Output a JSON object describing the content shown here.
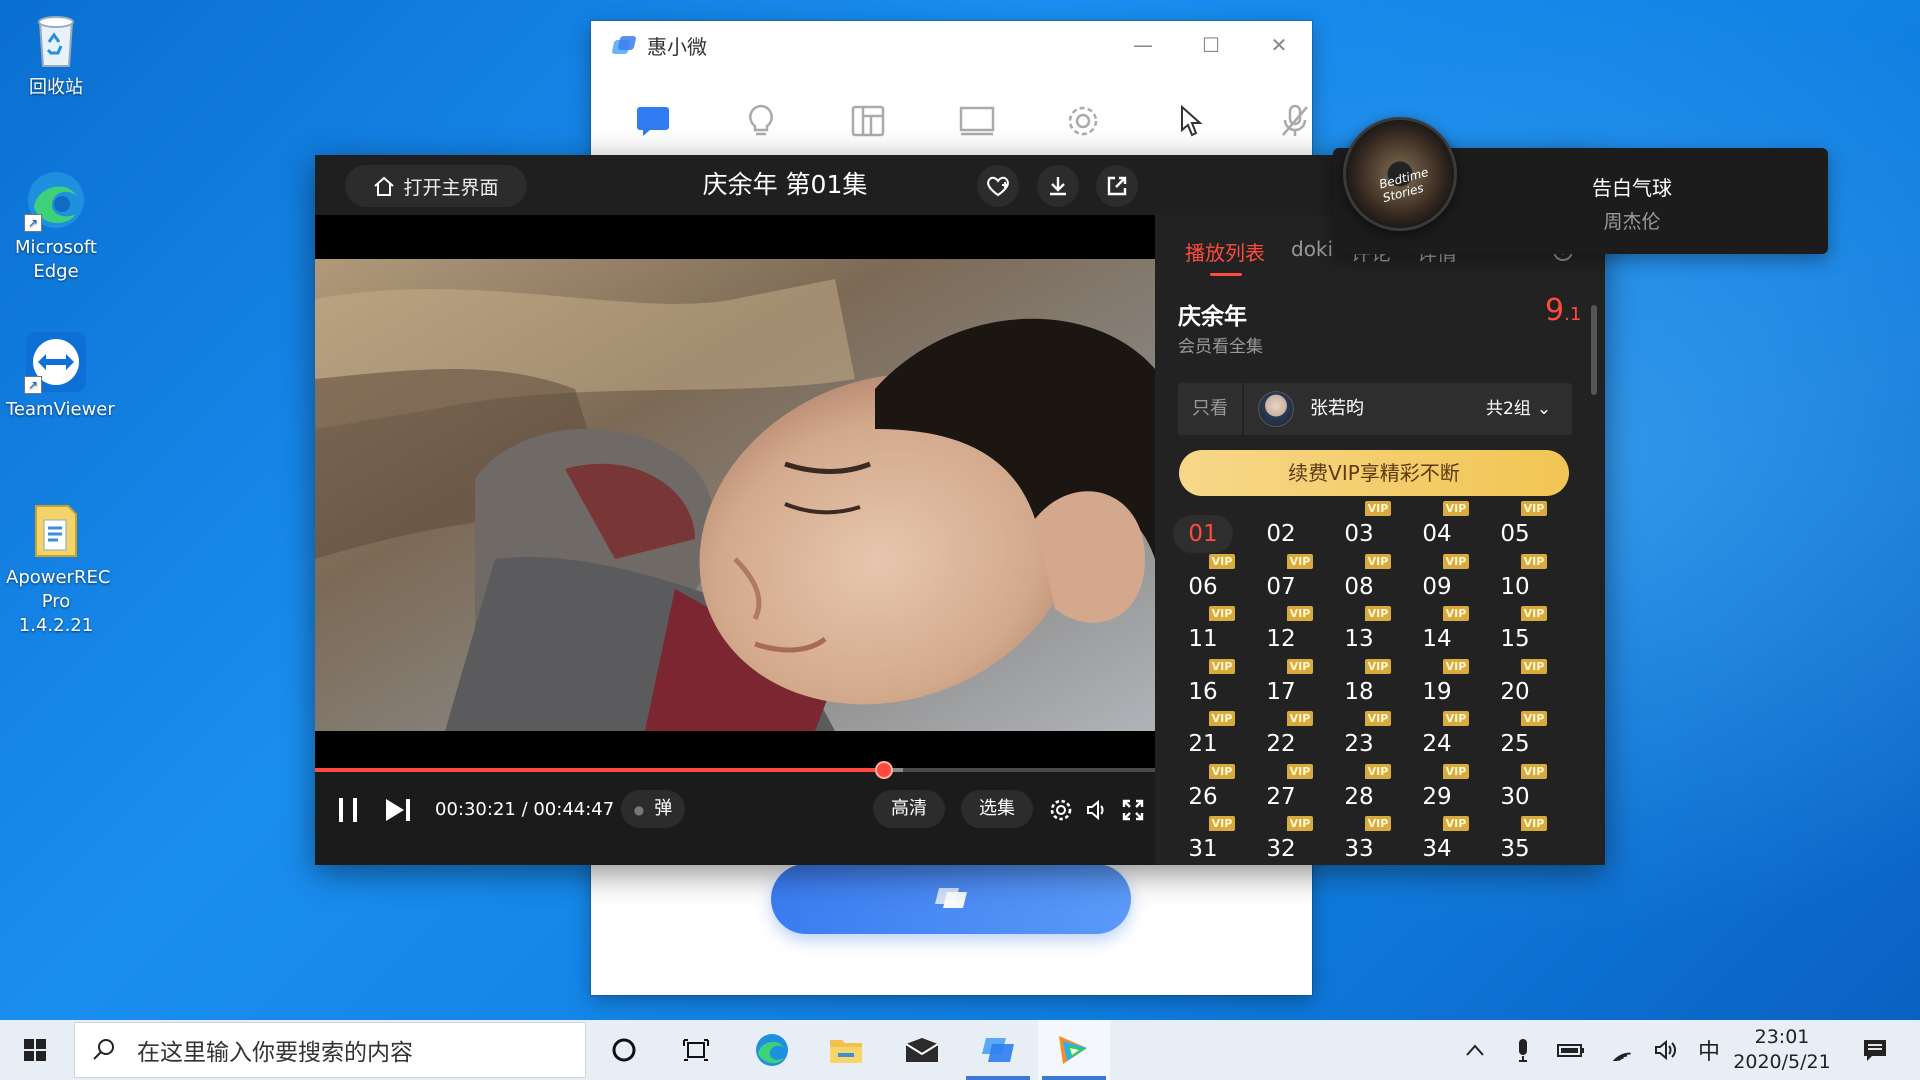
{
  "desktop": {
    "icons": [
      {
        "label": "回收站",
        "icon": "recycle-bin-icon"
      },
      {
        "label": "Microsoft Edge",
        "icon": "edge-icon"
      },
      {
        "label": "TeamViewer",
        "icon": "teamviewer-icon"
      },
      {
        "label": "ApowerREC Pro 1.4.2.21",
        "icon": "apowerrec-icon"
      }
    ]
  },
  "back_window": {
    "title": "惠小微",
    "controls": [
      "minimize",
      "maximize",
      "close"
    ],
    "toolbar_icons": [
      "chat-icon",
      "lightbulb-icon",
      "dashboard-icon",
      "screen-icon",
      "settings-icon",
      "pointer-icon",
      "mic-off-icon"
    ],
    "brand_colors": {
      "primary": "#3a7cf0"
    }
  },
  "player": {
    "home_label": "打开主界面",
    "title": "庆余年 第01集",
    "top_icons": [
      "favorite-icon",
      "download-icon",
      "share-icon"
    ],
    "time_current": "00:30:21",
    "time_separator": " / ",
    "time_total": "00:44:47",
    "progress": 0.677,
    "danmaku_label": "弹",
    "quality_label": "高清",
    "episodes_label": "选集",
    "accent": "#ff4a3d"
  },
  "playlist": {
    "tabs": [
      "播放列表",
      "doki",
      "评论",
      "详情"
    ],
    "active_tab": 0,
    "show_title": "庆余年",
    "show_subtitle": "会员看全集",
    "rating_main": "9",
    "rating_decimal": ".1",
    "filter_label": "只看",
    "actor_name": "张若昀",
    "groups_label": "共2组",
    "vip_button": "续费VIP享精彩不断",
    "vip_badge": "VIP",
    "current_episode": "01",
    "episodes": [
      "01",
      "02",
      "03",
      "04",
      "05",
      "06",
      "07",
      "08",
      "09",
      "10",
      "11",
      "12",
      "13",
      "14",
      "15",
      "16",
      "17",
      "18",
      "19",
      "20",
      "21",
      "22",
      "23",
      "24",
      "25",
      "26",
      "27",
      "28",
      "29",
      "30",
      "31",
      "32",
      "33",
      "34",
      "35"
    ],
    "vip_from_index": 2
  },
  "music": {
    "song": "告白气球",
    "artist": "周杰伦",
    "album_text": "Bedtime Stories"
  },
  "taskbar": {
    "search_placeholder": "在这里输入你要搜索的内容",
    "apps": [
      "cortana-icon",
      "task-view-icon",
      "edge-icon",
      "file-explorer-icon",
      "mail-icon",
      "huixiaowei-icon",
      "video-player-icon"
    ],
    "tray_icons": [
      "chevron-up-icon",
      "microphone-icon",
      "battery-icon",
      "wifi-icon",
      "volume-icon"
    ],
    "ime": "中",
    "time": "23:01",
    "date": "2020/5/21"
  }
}
